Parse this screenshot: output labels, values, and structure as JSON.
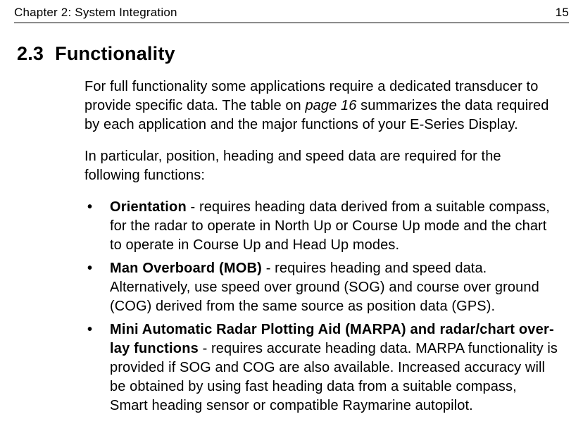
{
  "header": {
    "chapter": "Chapter 2: System Integration",
    "page_num": "15"
  },
  "section": {
    "number": "2.3",
    "title": "Functionality"
  },
  "para1_pre": "For full functionality some applications require a dedicated transducer to provide specific data. The table on ",
  "para1_ref": "page 16",
  "para1_post": " summarizes the data required by each application and the major functions of your E-Series Display.",
  "para2": "In particular, position, heading and speed data are required for the following functions:",
  "bullets": [
    {
      "lead": "Orientation",
      "rest": " - requires heading data derived from a suitable compass, for the radar to operate in North Up or Course Up mode and the chart to operate in Course Up and Head Up modes."
    },
    {
      "lead": "Man Overboard (MOB)",
      "rest": " - requires heading and speed data. Alternatively, use speed over ground (SOG) and course over ground (COG) derived from the same source as position data (GPS)."
    },
    {
      "lead": "Mini Automatic Radar Plotting Aid (MARPA) and radar/chart over­lay functions",
      "rest": " - requires accurate heading data. MARPA functionality is pro­vided if SOG and COG are also available. Increased accuracy will be obtained by using fast heading data from a suitable compass, Smart heading sensor or com­patible Raymarine autopilot."
    }
  ]
}
